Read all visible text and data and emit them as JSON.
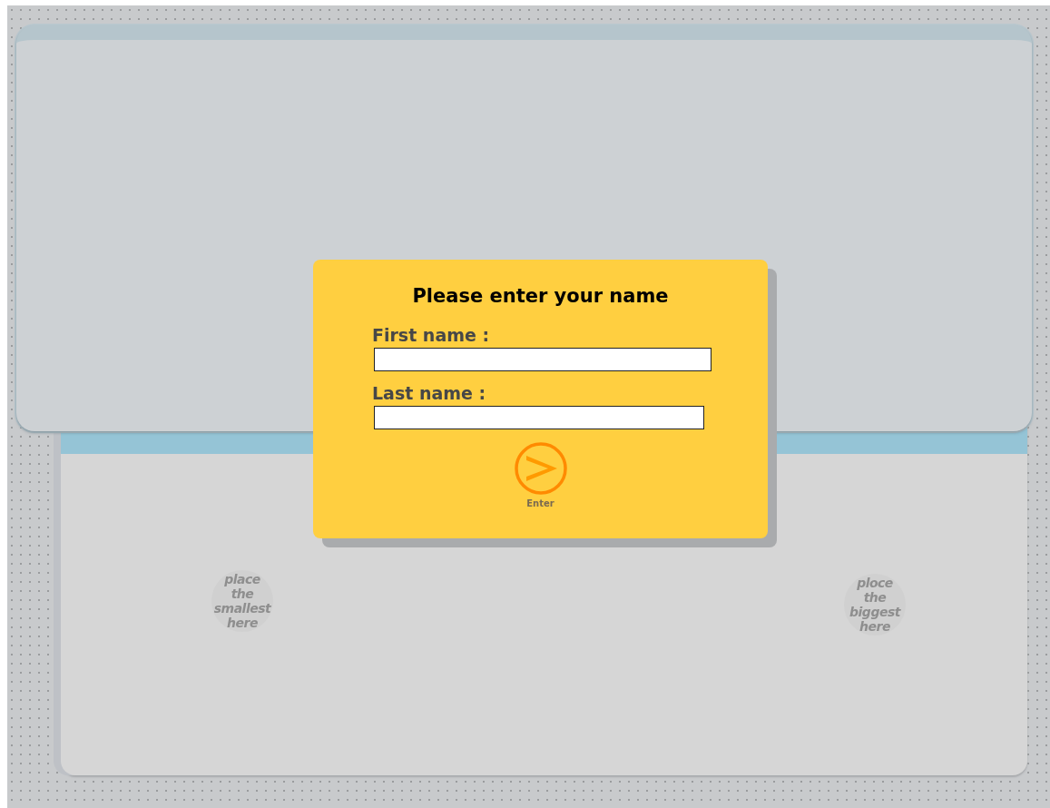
{
  "dialog": {
    "title": "Please enter your name",
    "fields": [
      {
        "label": "First name :"
      },
      {
        "label": "Last name :"
      }
    ],
    "submit": {
      "label": "Enter"
    }
  },
  "drop_slots": [
    {
      "text": "place\nthe smallest\nhere"
    },
    {
      "text": "ploce\nthe biggest\nhere"
    }
  ]
}
